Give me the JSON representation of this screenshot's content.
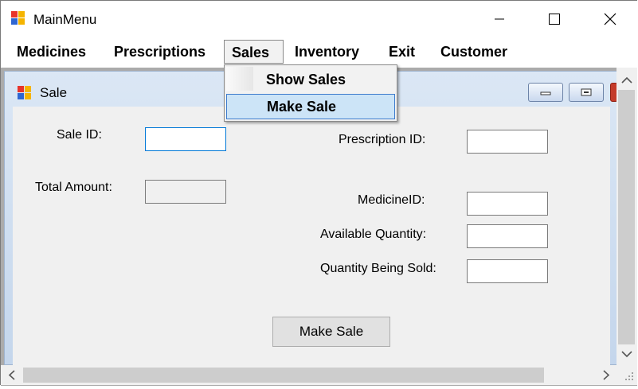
{
  "window": {
    "title": "MainMenu"
  },
  "menu": {
    "items": [
      "Medicines",
      "Prescriptions",
      "Sales",
      "Inventory",
      "Exit",
      "Customer"
    ],
    "active_index": 2
  },
  "dropdown": {
    "items": [
      "Show Sales",
      "Make Sale"
    ],
    "highlighted_index": 1
  },
  "child": {
    "title": "Sale"
  },
  "form": {
    "sale_id_label": "Sale ID:",
    "total_amount_label": "Total Amount:",
    "prescription_id_label": "Prescription ID:",
    "medicine_id_label": "MedicineID:",
    "available_quantity_label": "Available Quantity:",
    "quantity_sold_label": "Quantity Being Sold:",
    "sale_id_value": "",
    "total_amount_value": "",
    "prescription_id_value": "",
    "medicine_id_value": "",
    "available_quantity_value": "",
    "quantity_sold_value": "",
    "make_sale_button": "Make Sale"
  },
  "icons": {
    "app": "app-icon",
    "minimize": "minimize-icon",
    "maximize": "maximize-icon",
    "close": "close-icon",
    "scroll_up": "chevron-up-icon",
    "scroll_down": "chevron-down-icon",
    "scroll_left": "chevron-left-icon",
    "scroll_right": "chevron-right-icon"
  },
  "colors": {
    "accent": "#0078d7",
    "menu_highlight": "#cce4f7",
    "menu_highlight_border": "#3d7bcd",
    "mdi_background": "#ababab"
  }
}
